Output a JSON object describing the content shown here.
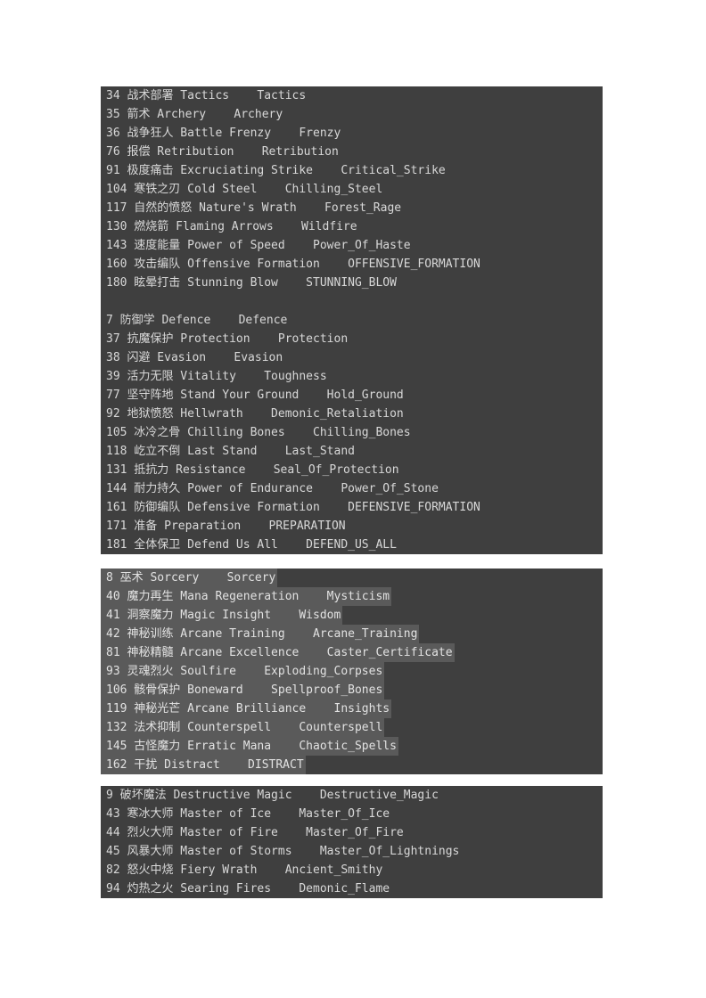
{
  "document": {
    "background_color": "#ffffff",
    "block_background_color": "#3f3f3f",
    "text_color": "#d8d8d8",
    "selection_background_color": "#5a5a5a",
    "selection_text_color": "#e2e2e2"
  },
  "blocks": [
    {
      "name": "offense-and-defense-skill-block",
      "selected": false,
      "lines": [
        "34 战术部署 Tactics    Tactics",
        "35 箭术 Archery    Archery",
        "36 战争狂人 Battle Frenzy    Frenzy",
        "76 报偿 Retribution    Retribution",
        "91 极度痛击 Excruciating Strike    Critical_Strike",
        "104 寒铁之刃 Cold Steel    Chilling_Steel",
        "117 自然的愤怒 Nature's Wrath    Forest_Rage",
        "130 燃烧箭 Flaming Arrows    Wildfire",
        "143 速度能量 Power of Speed    Power_Of_Haste",
        "160 攻击编队 Offensive Formation    OFFENSIVE_FORMATION",
        "180 眩晕打击 Stunning Blow    STUNNING_BLOW",
        "",
        "7 防御学 Defence    Defence",
        "37 抗魔保护 Protection    Protection",
        "38 闪避 Evasion    Evasion",
        "39 活力无限 Vitality    Toughness",
        "77 坚守阵地 Stand Your Ground    Hold_Ground",
        "92 地狱愤怒 Hellwrath    Demonic_Retaliation",
        "105 冰冷之骨 Chilling Bones    Chilling_Bones",
        "118 屹立不倒 Last Stand    Last_Stand",
        "131 抵抗力 Resistance    Seal_Of_Protection",
        "144 耐力持久 Power of Endurance    Power_Of_Stone",
        "161 防御编队 Defensive Formation    DEFENSIVE_FORMATION",
        "171 准备 Preparation    PREPARATION",
        "181 全体保卫 Defend Us All    DEFEND_US_ALL"
      ]
    },
    {
      "name": "sorcery-skill-block",
      "selected": true,
      "lines": [
        "8 巫术 Sorcery    Sorcery",
        "40 魔力再生 Mana Regeneration    Mysticism",
        "41 洞察魔力 Magic Insight    Wisdom",
        "42 神秘训练 Arcane Training    Arcane_Training",
        "81 神秘精髓 Arcane Excellence    Caster_Certificate",
        "93 灵魂烈火 Soulfire    Exploding_Corpses",
        "106 骸骨保护 Boneward    Spellproof_Bones",
        "119 神秘光芒 Arcane Brilliance    Insights",
        "132 法术抑制 Counterspell    Counterspell",
        "145 古怪魔力 Erratic Mana    Chaotic_Spells",
        "162 干扰 Distract    DISTRACT"
      ]
    },
    {
      "name": "destructive-magic-skill-block",
      "selected": false,
      "lines": [
        "9 破坏魔法 Destructive Magic    Destructive_Magic",
        "43 寒冰大师 Master of Ice    Master_Of_Ice",
        "44 烈火大师 Master of Fire    Master_Of_Fire",
        "45 风暴大师 Master of Storms    Master_Of_Lightnings",
        "82 怒火中烧 Fiery Wrath    Ancient_Smithy",
        "94 灼热之火 Searing Fires    Demonic_Flame"
      ]
    }
  ]
}
